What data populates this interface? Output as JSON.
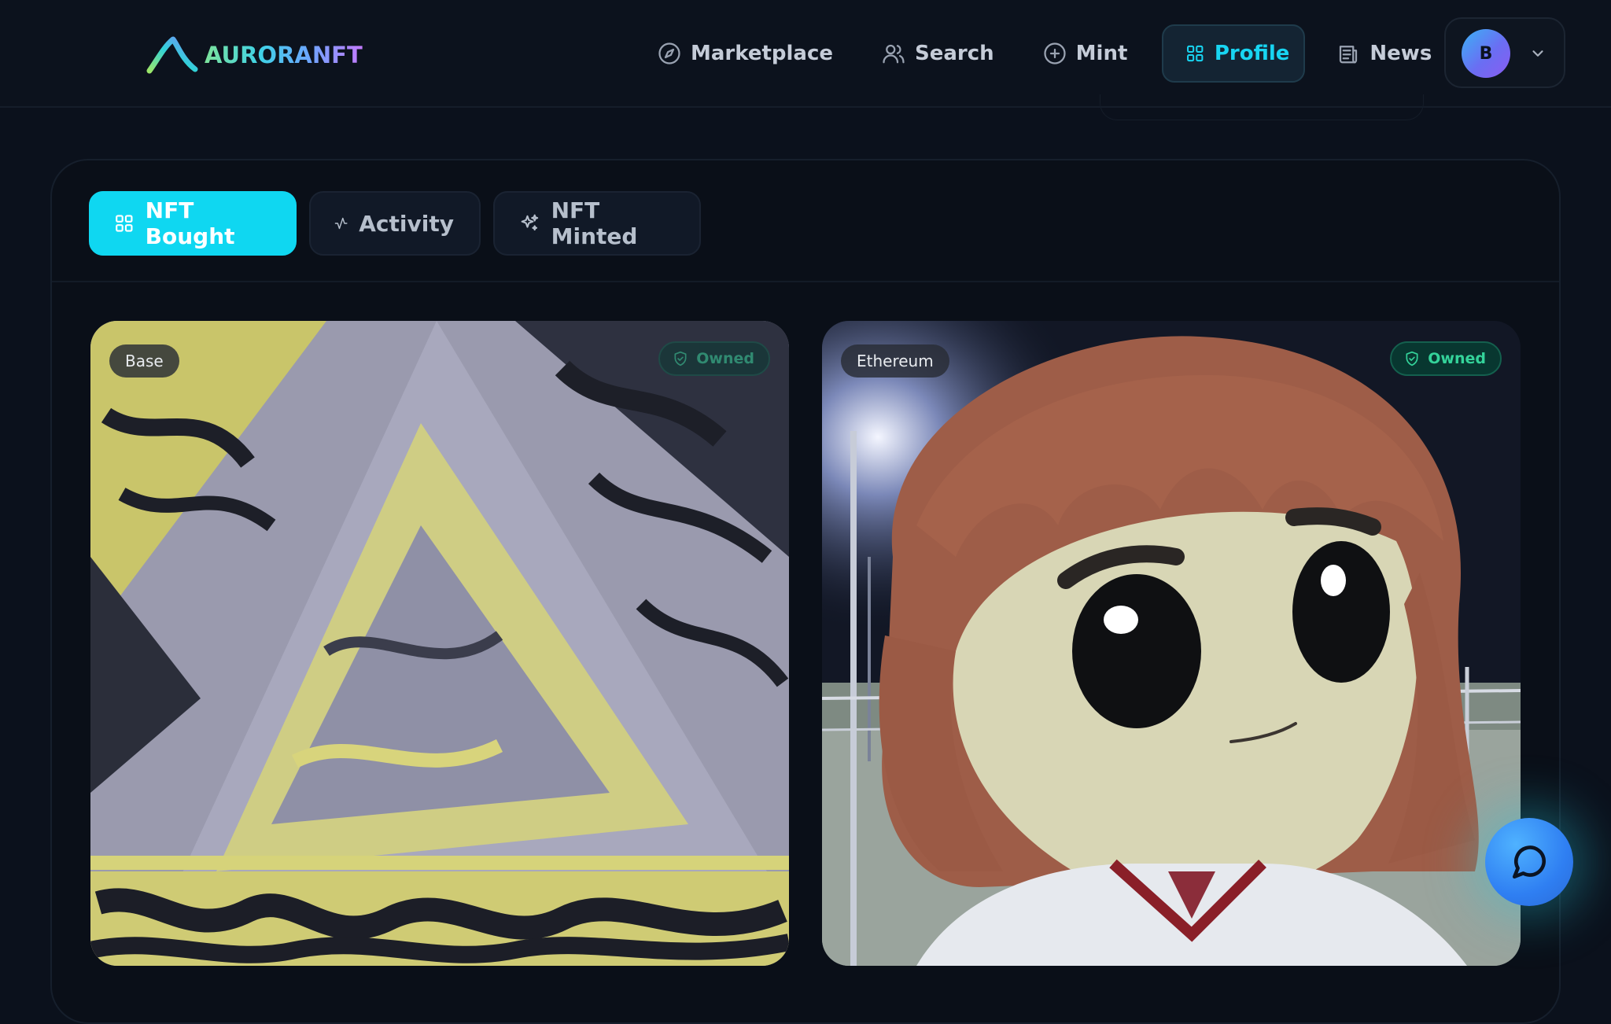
{
  "app": {
    "logo_text": "AURORANFT"
  },
  "nav": {
    "items": [
      {
        "label": "Marketplace",
        "icon": "compass-icon",
        "active": false
      },
      {
        "label": "Search",
        "icon": "users-icon",
        "active": false
      },
      {
        "label": "Mint",
        "icon": "plus-circle-icon",
        "active": false
      },
      {
        "label": "Profile",
        "icon": "grid-icon",
        "active": true
      },
      {
        "label": "News",
        "icon": "newspaper-icon",
        "active": false
      }
    ],
    "account": {
      "avatar_initial": "B",
      "menu_icon": "chevron-down-icon"
    }
  },
  "tabs": [
    {
      "label": "NFT Bought",
      "icon": "grid-icon",
      "active": true
    },
    {
      "label": "Activity",
      "icon": "activity-icon",
      "active": false
    },
    {
      "label": "NFT Minted",
      "icon": "sparkles-icon",
      "active": false
    }
  ],
  "cards": [
    {
      "chain": "Base",
      "status": "Owned"
    },
    {
      "chain": "Ethereum",
      "status": "Owned"
    }
  ],
  "chat": {
    "icon": "chat-bubble-icon"
  },
  "colors": {
    "accent": "#0fd7f1",
    "background": "#0b111c",
    "owned_green": "#34d39a",
    "avatar_gradient_start": "#3bb2f5",
    "avatar_gradient_end": "#8a5cf0"
  }
}
